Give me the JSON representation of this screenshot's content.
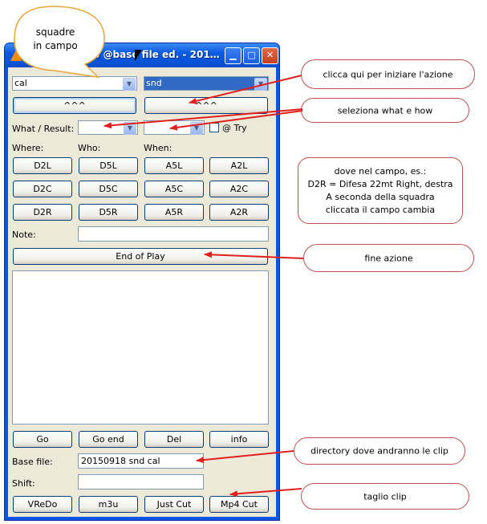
{
  "window": {
    "title": "6 @base file ed. - 201…"
  },
  "top": {
    "left_combo": "cal",
    "right_combo": "snd",
    "left_button": "^^^",
    "right_button": "^^^"
  },
  "what_result": {
    "label": "What / Result:",
    "try_label": "@ Try"
  },
  "sections": {
    "where": "Where:",
    "who": "Who:",
    "when": "When:"
  },
  "grid": [
    [
      "D2L",
      "D5L",
      "A5L",
      "A2L"
    ],
    [
      "D2C",
      "D5C",
      "A5C",
      "A2C"
    ],
    [
      "D2R",
      "D5R",
      "A5R",
      "A2R"
    ]
  ],
  "note_label": "Note:",
  "end_play": "End of Play",
  "actions": [
    "Go",
    "Go end",
    "Del",
    "info"
  ],
  "base_file": {
    "label": "Base file:",
    "value": "20150918 snd cal"
  },
  "shift_label": "Shift:",
  "bottom": [
    "VReDo",
    "m3u",
    "Just Cut",
    "Mp4 Cut"
  ],
  "callouts": {
    "speech": [
      "squadre",
      "in campo"
    ],
    "start_action": "clicca qui per iniziare l'azione",
    "what_how": "seleziona what e how",
    "field": [
      "dove nel campo, es.:",
      "D2R = Difesa 22mt Right, destra",
      "A seconda della squadra",
      "cliccata il campo cambia"
    ],
    "end": "fine azione",
    "directory": "directory dove andranno le clip",
    "cut": "taglio clip"
  },
  "colors": {
    "titlebar": "#0a55e3",
    "window_bg": "#ece9d8",
    "callout_border": "#c0504d",
    "arrow": "#e02020"
  }
}
